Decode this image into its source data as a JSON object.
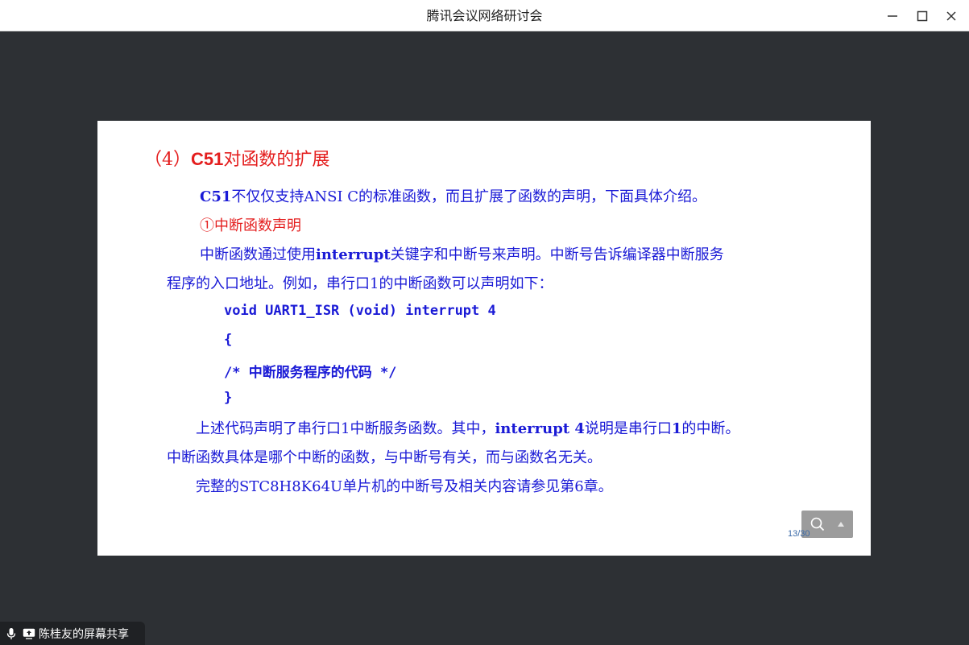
{
  "window": {
    "title": "腾讯会议网络研讨会",
    "minimize_icon": "minimize-icon",
    "maximize_icon": "maximize-icon",
    "close_icon": "close-icon"
  },
  "slide": {
    "title_prefix": "（4）",
    "title_bold": "C51",
    "title_rest": "对函数的扩展",
    "intro_bold": "C51",
    "intro_rest": "不仅仅支持ANSI C的标准函数，而且扩展了函数的声明，下面具体介绍。",
    "item1": "①中断函数声明",
    "para1_a": "中断函数通过使用",
    "para1_bold": "interrupt",
    "para1_b": "关键字和中断号来声明。中断号告诉编译器中断服务",
    "para1_line2": "程序的入口地址。例如，串行口1的中断函数可以声明如下：",
    "code": [
      "void UART1_ISR (void) interrupt 4",
      "{",
      "/* 中断服务程序的代码 */",
      "}"
    ],
    "para2_a": "上述代码声明了串行口1中断服务函数。其中，",
    "para2_bold": "interrupt 4",
    "para2_b": "说明是串行口",
    "para2_bold2": "1",
    "para2_c": "的中断。",
    "para2_line2": "中断函数具体是哪个中断的函数，与中断号有关，而与函数名无关。",
    "para3": "完整的STC8H8K64U单片机的中断号及相关内容请参见第6章。",
    "page_number": "13/30"
  },
  "share_badge": {
    "label": "陈桂友的屏幕共享",
    "mic_icon": "microphone-icon",
    "screen_icon": "screen-share-icon"
  },
  "colors": {
    "title_red": "#e41e1e",
    "text_blue": "#1a1ad6",
    "background": "#2d3034"
  }
}
